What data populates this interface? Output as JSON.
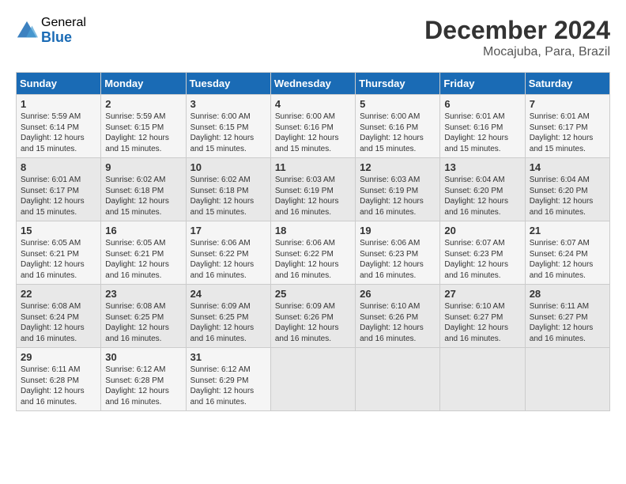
{
  "logo": {
    "general": "General",
    "blue": "Blue"
  },
  "title": {
    "month": "December 2024",
    "location": "Mocajuba, Para, Brazil"
  },
  "headers": [
    "Sunday",
    "Monday",
    "Tuesday",
    "Wednesday",
    "Thursday",
    "Friday",
    "Saturday"
  ],
  "weeks": [
    [
      {
        "day": "1",
        "sunrise": "5:59 AM",
        "sunset": "6:14 PM",
        "daylight": "12 hours and 15 minutes."
      },
      {
        "day": "2",
        "sunrise": "5:59 AM",
        "sunset": "6:15 PM",
        "daylight": "12 hours and 15 minutes."
      },
      {
        "day": "3",
        "sunrise": "6:00 AM",
        "sunset": "6:15 PM",
        "daylight": "12 hours and 15 minutes."
      },
      {
        "day": "4",
        "sunrise": "6:00 AM",
        "sunset": "6:16 PM",
        "daylight": "12 hours and 15 minutes."
      },
      {
        "day": "5",
        "sunrise": "6:00 AM",
        "sunset": "6:16 PM",
        "daylight": "12 hours and 15 minutes."
      },
      {
        "day": "6",
        "sunrise": "6:01 AM",
        "sunset": "6:16 PM",
        "daylight": "12 hours and 15 minutes."
      },
      {
        "day": "7",
        "sunrise": "6:01 AM",
        "sunset": "6:17 PM",
        "daylight": "12 hours and 15 minutes."
      }
    ],
    [
      {
        "day": "8",
        "sunrise": "6:01 AM",
        "sunset": "6:17 PM",
        "daylight": "12 hours and 15 minutes."
      },
      {
        "day": "9",
        "sunrise": "6:02 AM",
        "sunset": "6:18 PM",
        "daylight": "12 hours and 15 minutes."
      },
      {
        "day": "10",
        "sunrise": "6:02 AM",
        "sunset": "6:18 PM",
        "daylight": "12 hours and 15 minutes."
      },
      {
        "day": "11",
        "sunrise": "6:03 AM",
        "sunset": "6:19 PM",
        "daylight": "12 hours and 16 minutes."
      },
      {
        "day": "12",
        "sunrise": "6:03 AM",
        "sunset": "6:19 PM",
        "daylight": "12 hours and 16 minutes."
      },
      {
        "day": "13",
        "sunrise": "6:04 AM",
        "sunset": "6:20 PM",
        "daylight": "12 hours and 16 minutes."
      },
      {
        "day": "14",
        "sunrise": "6:04 AM",
        "sunset": "6:20 PM",
        "daylight": "12 hours and 16 minutes."
      }
    ],
    [
      {
        "day": "15",
        "sunrise": "6:05 AM",
        "sunset": "6:21 PM",
        "daylight": "12 hours and 16 minutes."
      },
      {
        "day": "16",
        "sunrise": "6:05 AM",
        "sunset": "6:21 PM",
        "daylight": "12 hours and 16 minutes."
      },
      {
        "day": "17",
        "sunrise": "6:06 AM",
        "sunset": "6:22 PM",
        "daylight": "12 hours and 16 minutes."
      },
      {
        "day": "18",
        "sunrise": "6:06 AM",
        "sunset": "6:22 PM",
        "daylight": "12 hours and 16 minutes."
      },
      {
        "day": "19",
        "sunrise": "6:06 AM",
        "sunset": "6:23 PM",
        "daylight": "12 hours and 16 minutes."
      },
      {
        "day": "20",
        "sunrise": "6:07 AM",
        "sunset": "6:23 PM",
        "daylight": "12 hours and 16 minutes."
      },
      {
        "day": "21",
        "sunrise": "6:07 AM",
        "sunset": "6:24 PM",
        "daylight": "12 hours and 16 minutes."
      }
    ],
    [
      {
        "day": "22",
        "sunrise": "6:08 AM",
        "sunset": "6:24 PM",
        "daylight": "12 hours and 16 minutes."
      },
      {
        "day": "23",
        "sunrise": "6:08 AM",
        "sunset": "6:25 PM",
        "daylight": "12 hours and 16 minutes."
      },
      {
        "day": "24",
        "sunrise": "6:09 AM",
        "sunset": "6:25 PM",
        "daylight": "12 hours and 16 minutes."
      },
      {
        "day": "25",
        "sunrise": "6:09 AM",
        "sunset": "6:26 PM",
        "daylight": "12 hours and 16 minutes."
      },
      {
        "day": "26",
        "sunrise": "6:10 AM",
        "sunset": "6:26 PM",
        "daylight": "12 hours and 16 minutes."
      },
      {
        "day": "27",
        "sunrise": "6:10 AM",
        "sunset": "6:27 PM",
        "daylight": "12 hours and 16 minutes."
      },
      {
        "day": "28",
        "sunrise": "6:11 AM",
        "sunset": "6:27 PM",
        "daylight": "12 hours and 16 minutes."
      }
    ],
    [
      {
        "day": "29",
        "sunrise": "6:11 AM",
        "sunset": "6:28 PM",
        "daylight": "12 hours and 16 minutes."
      },
      {
        "day": "30",
        "sunrise": "6:12 AM",
        "sunset": "6:28 PM",
        "daylight": "12 hours and 16 minutes."
      },
      {
        "day": "31",
        "sunrise": "6:12 AM",
        "sunset": "6:29 PM",
        "daylight": "12 hours and 16 minutes."
      },
      null,
      null,
      null,
      null
    ]
  ]
}
